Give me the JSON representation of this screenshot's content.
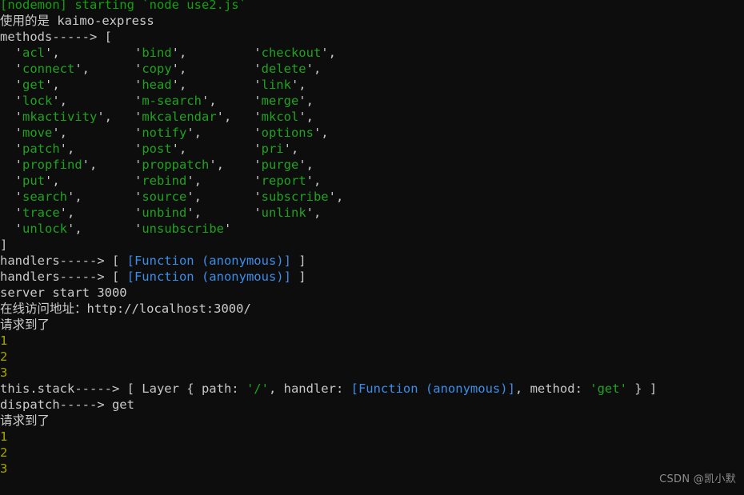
{
  "terminal": {
    "background_color": "#0d0d0d",
    "colors": {
      "green": "#1fa31f",
      "white": "#cccccc",
      "cyan": "#3b8eea",
      "yellow": "#a5a500",
      "punctuation": "#c8c8c8"
    },
    "lines": [
      {
        "id": "l01",
        "text": "[nodemon] starting `node use2.js`",
        "color": "green"
      },
      {
        "id": "l02",
        "text": "使用的是 kaimo-express",
        "color": "white"
      },
      {
        "id": "l03",
        "text": "methods-----> [",
        "color": "white"
      },
      {
        "id": "l04",
        "text": "  'acl',          'bind',         'checkout',",
        "color": "mixed"
      },
      {
        "id": "l05",
        "text": "  'connect',      'copy',         'delete',",
        "color": "mixed"
      },
      {
        "id": "l06",
        "text": "  'get',          'head',         'link',",
        "color": "mixed"
      },
      {
        "id": "l07",
        "text": "  'lock',         'm-search',     'merge',",
        "color": "mixed"
      },
      {
        "id": "l08",
        "text": "  'mkactivity',   'mkcalendar',   'mkcol',",
        "color": "mixed"
      },
      {
        "id": "l09",
        "text": "  'move',         'notify',       'options',",
        "color": "mixed"
      },
      {
        "id": "l10",
        "text": "  'patch',        'post',         'pri',",
        "color": "mixed"
      },
      {
        "id": "l11",
        "text": "  'propfind',     'proppatch',    'purge',",
        "color": "mixed"
      },
      {
        "id": "l12",
        "text": "  'put',          'rebind',       'report',",
        "color": "mixed"
      },
      {
        "id": "l13",
        "text": "  'search',       'source',       'subscribe',",
        "color": "mixed"
      },
      {
        "id": "l14",
        "text": "  'trace',        'unbind',       'unlink',",
        "color": "mixed"
      },
      {
        "id": "l15",
        "text": "  'unlock',       'unsubscribe'",
        "color": "mixed"
      },
      {
        "id": "l16",
        "text": "]",
        "color": "white"
      },
      {
        "id": "l17",
        "text": "handlers-----> [ [Function (anonymous)] ]",
        "color": "mixed"
      },
      {
        "id": "l18",
        "text": "handlers-----> [ [Function (anonymous)] ]",
        "color": "mixed"
      },
      {
        "id": "l19",
        "text": "server start 3000",
        "color": "white"
      },
      {
        "id": "l20",
        "text": "在线访问地址：http://localhost:3000/",
        "color": "white"
      },
      {
        "id": "l21",
        "text": "请求到了",
        "color": "white"
      },
      {
        "id": "l22",
        "text": "1",
        "color": "yellow"
      },
      {
        "id": "l23",
        "text": "2",
        "color": "yellow"
      },
      {
        "id": "l24",
        "text": "3",
        "color": "yellow"
      },
      {
        "id": "l25",
        "text": "this.stack-----> [ Layer { path: '/', handler: [Function (anonymous)], method: 'get' } ]",
        "color": "mixed"
      },
      {
        "id": "l26",
        "text": "dispatch-----> get",
        "color": "white"
      },
      {
        "id": "l27",
        "text": "请求到了",
        "color": "white"
      },
      {
        "id": "l28",
        "text": "1",
        "color": "yellow"
      },
      {
        "id": "l29",
        "text": "2",
        "color": "yellow"
      },
      {
        "id": "l30",
        "text": "3",
        "color": "yellow"
      }
    ],
    "segments": {
      "l01": [
        {
          "t": "[nodemon] starting `node use2.js`",
          "c": "brgreen"
        }
      ],
      "l02": [
        {
          "t": "使用的是 kaimo-express",
          "c": "white"
        }
      ],
      "l03": [
        {
          "t": "methods-----> [",
          "c": "punct"
        }
      ],
      "l04": [
        {
          "t": "  '",
          "c": "punct"
        },
        {
          "t": "acl",
          "c": "green"
        },
        {
          "t": "',          '",
          "c": "punct"
        },
        {
          "t": "bind",
          "c": "green"
        },
        {
          "t": "',         '",
          "c": "punct"
        },
        {
          "t": "checkout",
          "c": "green"
        },
        {
          "t": "',",
          "c": "punct"
        }
      ],
      "l05": [
        {
          "t": "  '",
          "c": "punct"
        },
        {
          "t": "connect",
          "c": "green"
        },
        {
          "t": "',      '",
          "c": "punct"
        },
        {
          "t": "copy",
          "c": "green"
        },
        {
          "t": "',         '",
          "c": "punct"
        },
        {
          "t": "delete",
          "c": "green"
        },
        {
          "t": "',",
          "c": "punct"
        }
      ],
      "l06": [
        {
          "t": "  '",
          "c": "punct"
        },
        {
          "t": "get",
          "c": "green"
        },
        {
          "t": "',          '",
          "c": "punct"
        },
        {
          "t": "head",
          "c": "green"
        },
        {
          "t": "',         '",
          "c": "punct"
        },
        {
          "t": "link",
          "c": "green"
        },
        {
          "t": "',",
          "c": "punct"
        }
      ],
      "l07": [
        {
          "t": "  '",
          "c": "punct"
        },
        {
          "t": "lock",
          "c": "green"
        },
        {
          "t": "',         '",
          "c": "punct"
        },
        {
          "t": "m-search",
          "c": "green"
        },
        {
          "t": "',     '",
          "c": "punct"
        },
        {
          "t": "merge",
          "c": "green"
        },
        {
          "t": "',",
          "c": "punct"
        }
      ],
      "l08": [
        {
          "t": "  '",
          "c": "punct"
        },
        {
          "t": "mkactivity",
          "c": "green"
        },
        {
          "t": "',   '",
          "c": "punct"
        },
        {
          "t": "mkcalendar",
          "c": "green"
        },
        {
          "t": "',   '",
          "c": "punct"
        },
        {
          "t": "mkcol",
          "c": "green"
        },
        {
          "t": "',",
          "c": "punct"
        }
      ],
      "l09": [
        {
          "t": "  '",
          "c": "punct"
        },
        {
          "t": "move",
          "c": "green"
        },
        {
          "t": "',         '",
          "c": "punct"
        },
        {
          "t": "notify",
          "c": "green"
        },
        {
          "t": "',       '",
          "c": "punct"
        },
        {
          "t": "options",
          "c": "green"
        },
        {
          "t": "',",
          "c": "punct"
        }
      ],
      "l10": [
        {
          "t": "  '",
          "c": "punct"
        },
        {
          "t": "patch",
          "c": "green"
        },
        {
          "t": "',        '",
          "c": "punct"
        },
        {
          "t": "post",
          "c": "green"
        },
        {
          "t": "',         '",
          "c": "punct"
        },
        {
          "t": "pri",
          "c": "green"
        },
        {
          "t": "',",
          "c": "punct"
        }
      ],
      "l11": [
        {
          "t": "  '",
          "c": "punct"
        },
        {
          "t": "propfind",
          "c": "green"
        },
        {
          "t": "',     '",
          "c": "punct"
        },
        {
          "t": "proppatch",
          "c": "green"
        },
        {
          "t": "',    '",
          "c": "punct"
        },
        {
          "t": "purge",
          "c": "green"
        },
        {
          "t": "',",
          "c": "punct"
        }
      ],
      "l12": [
        {
          "t": "  '",
          "c": "punct"
        },
        {
          "t": "put",
          "c": "green"
        },
        {
          "t": "',          '",
          "c": "punct"
        },
        {
          "t": "rebind",
          "c": "green"
        },
        {
          "t": "',       '",
          "c": "punct"
        },
        {
          "t": "report",
          "c": "green"
        },
        {
          "t": "',",
          "c": "punct"
        }
      ],
      "l13": [
        {
          "t": "  '",
          "c": "punct"
        },
        {
          "t": "search",
          "c": "green"
        },
        {
          "t": "',       '",
          "c": "punct"
        },
        {
          "t": "source",
          "c": "green"
        },
        {
          "t": "',       '",
          "c": "punct"
        },
        {
          "t": "subscribe",
          "c": "green"
        },
        {
          "t": "',",
          "c": "punct"
        }
      ],
      "l14": [
        {
          "t": "  '",
          "c": "punct"
        },
        {
          "t": "trace",
          "c": "green"
        },
        {
          "t": "',        '",
          "c": "punct"
        },
        {
          "t": "unbind",
          "c": "green"
        },
        {
          "t": "',       '",
          "c": "punct"
        },
        {
          "t": "unlink",
          "c": "green"
        },
        {
          "t": "',",
          "c": "punct"
        }
      ],
      "l15": [
        {
          "t": "  '",
          "c": "punct"
        },
        {
          "t": "unlock",
          "c": "green"
        },
        {
          "t": "',       '",
          "c": "punct"
        },
        {
          "t": "unsubscribe",
          "c": "green"
        },
        {
          "t": "'",
          "c": "punct"
        }
      ],
      "l16": [
        {
          "t": "]",
          "c": "punct"
        }
      ],
      "l17": [
        {
          "t": "handlers-----> [ ",
          "c": "punct"
        },
        {
          "t": "[Function (anonymous)]",
          "c": "cyan"
        },
        {
          "t": " ]",
          "c": "punct"
        }
      ],
      "l18": [
        {
          "t": "handlers-----> [ ",
          "c": "punct"
        },
        {
          "t": "[Function (anonymous)]",
          "c": "cyan"
        },
        {
          "t": " ]",
          "c": "punct"
        }
      ],
      "l19": [
        {
          "t": "server start 3000",
          "c": "white"
        }
      ],
      "l20": [
        {
          "t": "在线访问地址：http://localhost:3000/",
          "c": "white"
        }
      ],
      "l21": [
        {
          "t": "请求到了",
          "c": "white"
        }
      ],
      "l22": [
        {
          "t": "1",
          "c": "yellow"
        }
      ],
      "l23": [
        {
          "t": "2",
          "c": "yellow"
        }
      ],
      "l24": [
        {
          "t": "3",
          "c": "yellow"
        }
      ],
      "l25": [
        {
          "t": "this.stack-----> [ Layer { path: ",
          "c": "punct"
        },
        {
          "t": "'/'",
          "c": "green"
        },
        {
          "t": ", handler: ",
          "c": "punct"
        },
        {
          "t": "[Function (anonymous)]",
          "c": "cyan"
        },
        {
          "t": ", method: ",
          "c": "punct"
        },
        {
          "t": "'get'",
          "c": "green"
        },
        {
          "t": " } ]",
          "c": "punct"
        }
      ],
      "l26": [
        {
          "t": "dispatch-----> get",
          "c": "white"
        }
      ],
      "l27": [
        {
          "t": "请求到了",
          "c": "white"
        }
      ],
      "l28": [
        {
          "t": "1",
          "c": "yellow"
        }
      ],
      "l29": [
        {
          "t": "2",
          "c": "yellow"
        }
      ],
      "l30": [
        {
          "t": "3",
          "c": "yellow"
        }
      ]
    }
  },
  "watermark": {
    "text": "CSDN @凯小默"
  }
}
